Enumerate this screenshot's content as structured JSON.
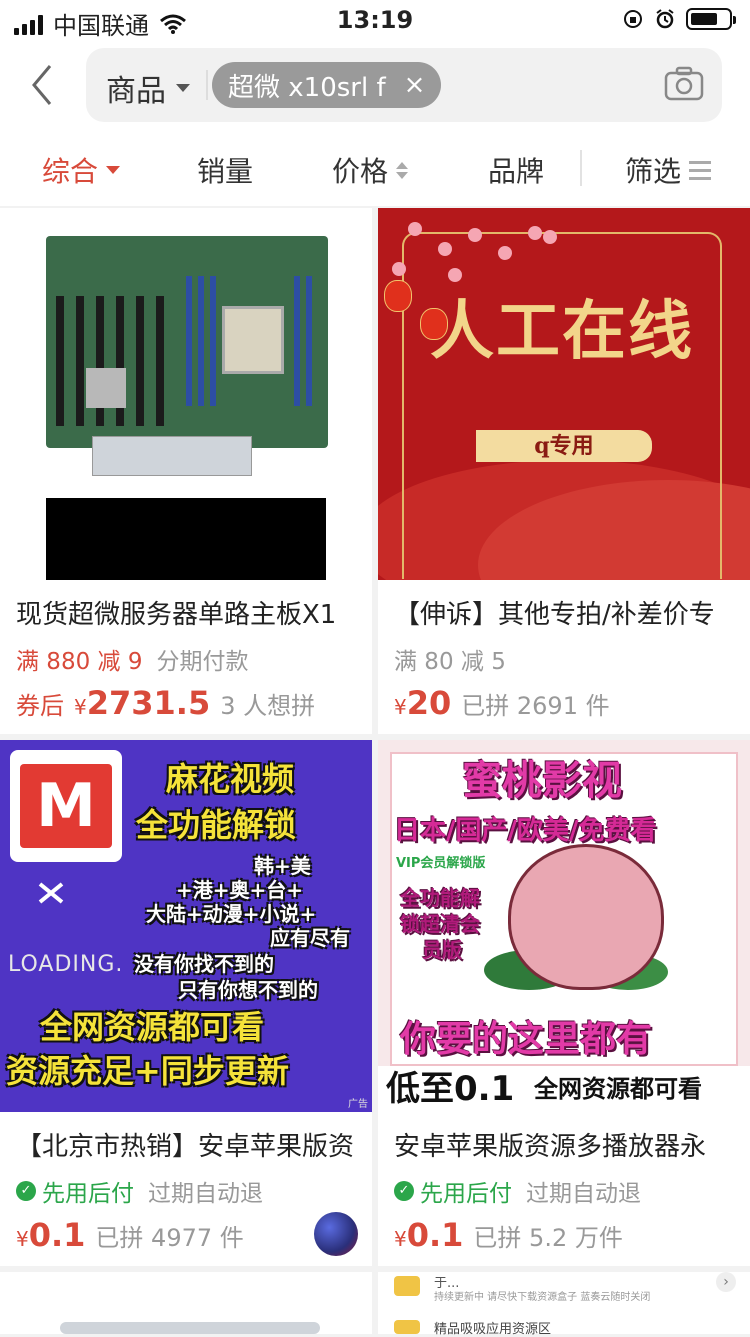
{
  "status_bar": {
    "carrier": "中国联通",
    "time": "13:19"
  },
  "search": {
    "scope_label": "商品",
    "query_chip": "超微 x10srl f",
    "chip_close": "×"
  },
  "sort_bar": {
    "items": [
      "综合",
      "销量",
      "价格",
      "品牌",
      "筛选"
    ],
    "active_index": 0
  },
  "products": [
    {
      "title": "现货超微服务器单路主板X1",
      "promo": "满 880 减 9",
      "promo_extra": "分期付款",
      "price_prefix": "券后",
      "price_yen": "¥",
      "price": "2731.5",
      "sold": "3 人想拼"
    },
    {
      "title": "【伸诉】其他专拍/补差价专",
      "promo": "满 80 减 5",
      "price_yen": "¥",
      "price": "20",
      "sold": "已拼 2691 件",
      "image_text": {
        "headline": "人工在线",
        "banner": "q专用"
      }
    },
    {
      "title": "【北京市热销】安卓苹果版资",
      "promo_badge": "先用后付",
      "promo_extra": "过期自动退",
      "price_yen": "¥",
      "price": "0.1",
      "sold": "已拼 4977 件",
      "image_text": {
        "logo": "M",
        "l1": "麻花视频",
        "l2": "全功能解锁",
        "l3": "韩+美",
        "l4": "+港+奥+台+",
        "l5": "大陆+动漫+小说+",
        "l6": "应有尽有",
        "loading": "LOADING.",
        "l7": "没有你找不到的",
        "l8": "只有你想不到的",
        "l9": "全网资源都可看",
        "l10": "资源充足+同步更新",
        "ad": "广告"
      }
    },
    {
      "title": "安卓苹果版资源多播放器永",
      "promo_badge": "先用后付",
      "promo_extra": "过期自动退",
      "price_yen": "¥",
      "price": "0.1",
      "sold": "已拼 5.2 万件",
      "image_text": {
        "l1": "蜜桃影视",
        "l2": "日本/国产/欧美/免费看",
        "l3": "VIP会员解锁版",
        "l4": "全功能解",
        "l5": "锁超清会",
        "l6": "员版",
        "l7": "你要的这里都有",
        "l8": "低至0.1",
        "l9": "全网资源都可看"
      }
    }
  ],
  "partial_row": {
    "right_line1": "持续更新中 请尽快下载资源盒子 蓝奏云随时关闭",
    "right_line2": "精品吸吸应用资源区",
    "right_line0": "于..."
  }
}
